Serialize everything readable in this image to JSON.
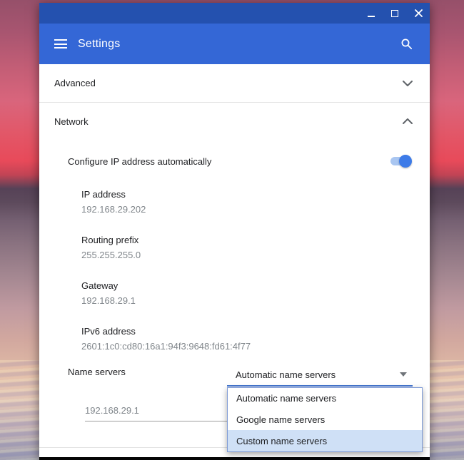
{
  "colors": {
    "titlebar": "#2451af",
    "header": "#3467d6",
    "toggle_on": "#3d7be8",
    "select_focus_underline": "#4577d0",
    "popup_highlight": "#cfe0f6"
  },
  "window": {
    "controls": {
      "minimize": "minimize",
      "maximize": "maximize",
      "close": "close"
    }
  },
  "header": {
    "title": "Settings",
    "menu_icon": "hamburger-icon",
    "search_icon": "search-icon"
  },
  "sections": {
    "advanced": {
      "label": "Advanced",
      "state": "collapsed"
    },
    "network": {
      "label": "Network",
      "state": "expanded"
    }
  },
  "network": {
    "configure_ip": {
      "label": "Configure IP address automatically",
      "enabled": true
    },
    "fields": [
      {
        "label": "IP address",
        "value": "192.168.29.202"
      },
      {
        "label": "Routing prefix",
        "value": "255.255.255.0"
      },
      {
        "label": "Gateway",
        "value": "192.168.29.1"
      },
      {
        "label": "IPv6 address",
        "value": "2601:1c0:cd80:16a1:94f3:9648:fd61:4f77"
      }
    ],
    "name_servers": {
      "label": "Name servers",
      "selected": "Automatic name servers",
      "options": [
        "Automatic name servers",
        "Google name servers",
        "Custom name servers"
      ],
      "highlighted_option": "Custom name servers",
      "custom_dns_value": "192.168.29.1"
    }
  }
}
